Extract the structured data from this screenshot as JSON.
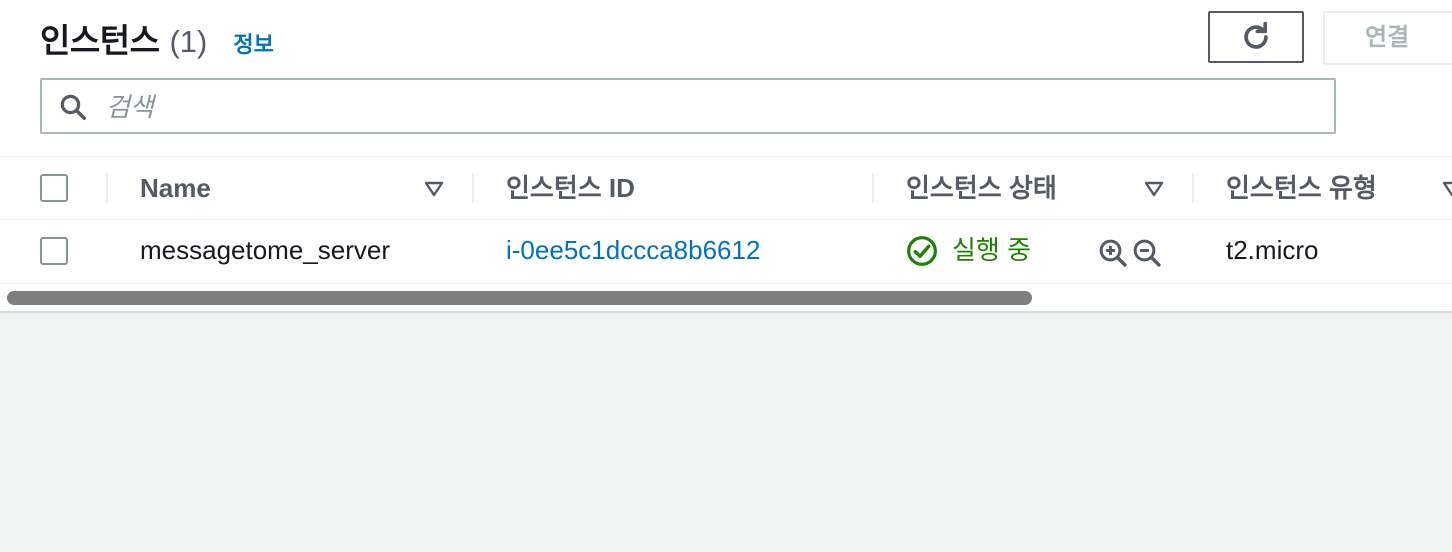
{
  "header": {
    "title": "인스턴스",
    "count": "(1)",
    "info_link": "정보"
  },
  "actions": {
    "refresh_icon": "refresh-icon",
    "connect_label": "연결"
  },
  "search": {
    "placeholder": "검색",
    "value": ""
  },
  "table": {
    "columns": [
      {
        "label": "Name"
      },
      {
        "label": "인스턴스 ID"
      },
      {
        "label": "인스턴스 상태"
      },
      {
        "label": "인스턴스 유형"
      }
    ],
    "rows": [
      {
        "name": "messagetome_server",
        "instance_id": "i-0ee5c1dccca8b6612",
        "state": "실행 중",
        "type": "t2.micro",
        "selected": false
      }
    ]
  },
  "colors": {
    "link": "#0073bb",
    "status_running": "#1d8102",
    "header_text": "#545b64",
    "border": "#eaeded"
  }
}
